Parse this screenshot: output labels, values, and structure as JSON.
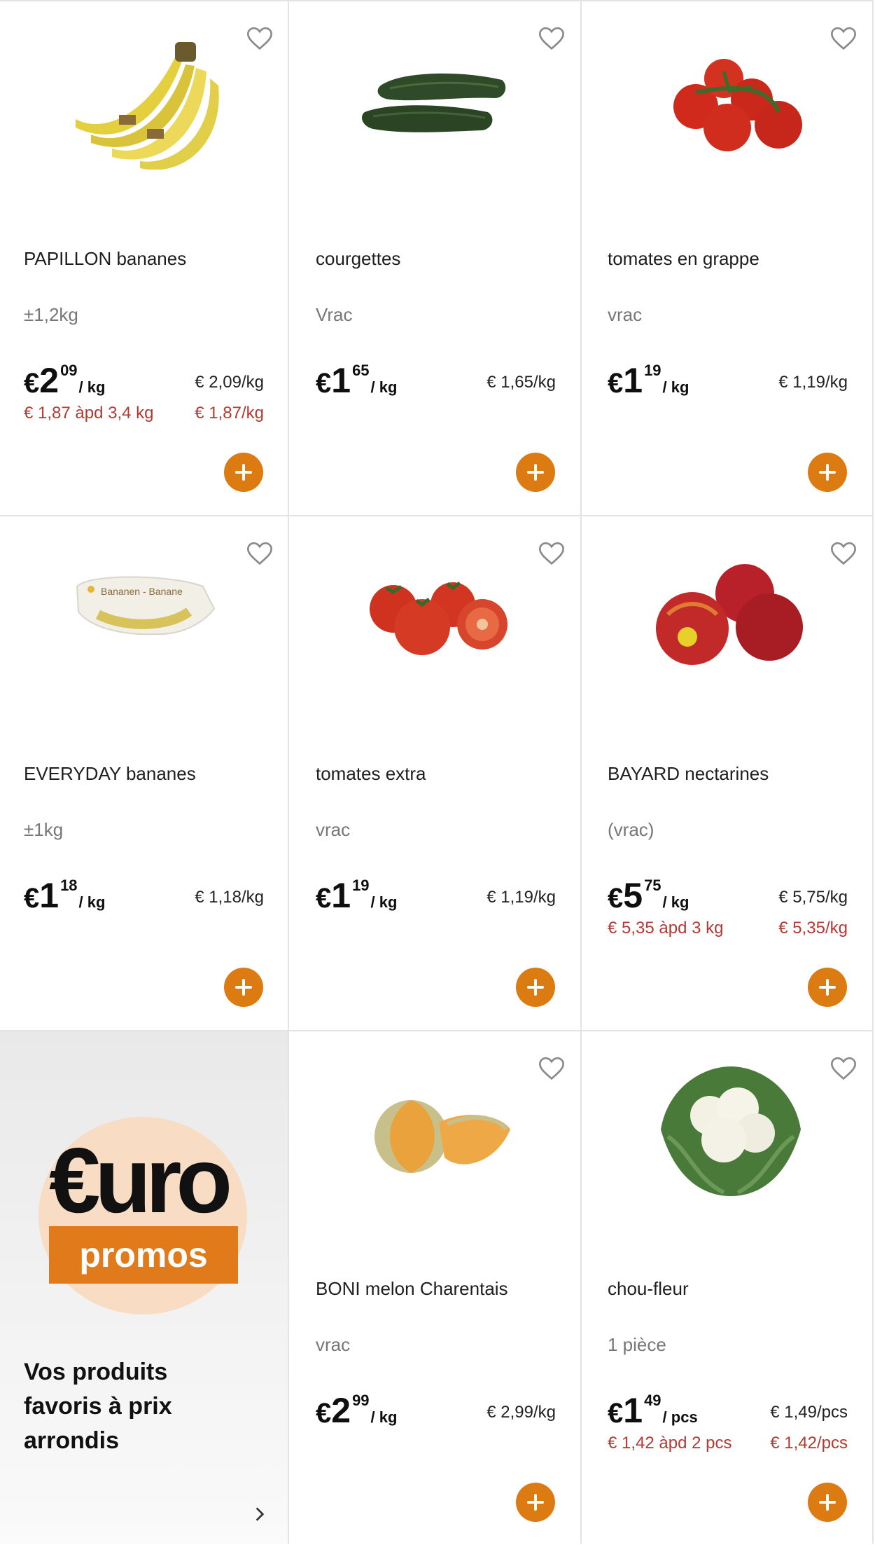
{
  "colors": {
    "accent": "#dc7b12",
    "promo_red": "#b23a33",
    "muted": "#777777",
    "border": "#e3e3e3"
  },
  "products": [
    {
      "name": "PAPILLON bananes",
      "quantity": "±1,2kg",
      "price": {
        "currency": "€",
        "int": "2",
        "cents": "09",
        "unit": "/ kg"
      },
      "unit_price": "€ 2,09/kg",
      "promo_text": "€ 1,87 àpd 3,4 kg",
      "promo_unit_price": "€ 1,87/kg",
      "image_icon": "bananas-image",
      "favorite_icon": "heart-outline-icon",
      "add_icon": "plus-icon"
    },
    {
      "name": "courgettes",
      "quantity": "Vrac",
      "price": {
        "currency": "€",
        "int": "1",
        "cents": "65",
        "unit": "/ kg"
      },
      "unit_price": "€ 1,65/kg",
      "image_icon": "courgettes-image",
      "favorite_icon": "heart-outline-icon",
      "add_icon": "plus-icon"
    },
    {
      "name": "tomates en grappe",
      "quantity": "vrac",
      "price": {
        "currency": "€",
        "int": "1",
        "cents": "19",
        "unit": "/ kg"
      },
      "unit_price": "€ 1,19/kg",
      "image_icon": "vine-tomatoes-image",
      "favorite_icon": "heart-outline-icon",
      "add_icon": "plus-icon"
    },
    {
      "name": "EVERYDAY bananes",
      "quantity": "±1kg",
      "price": {
        "currency": "€",
        "int": "1",
        "cents": "18",
        "unit": "/ kg"
      },
      "unit_price": "€ 1,18/kg",
      "image_icon": "bagged-bananas-image",
      "favorite_icon": "heart-outline-icon",
      "add_icon": "plus-icon"
    },
    {
      "name": "tomates extra",
      "quantity": "vrac",
      "price": {
        "currency": "€",
        "int": "1",
        "cents": "19",
        "unit": "/ kg"
      },
      "unit_price": "€ 1,19/kg",
      "image_icon": "tomatoes-image",
      "favorite_icon": "heart-outline-icon",
      "add_icon": "plus-icon"
    },
    {
      "name": "BAYARD nectarines",
      "quantity": "(vrac)",
      "price": {
        "currency": "€",
        "int": "5",
        "cents": "75",
        "unit": "/ kg"
      },
      "unit_price": "€ 5,75/kg",
      "promo_text": "€ 5,35 àpd 3 kg",
      "promo_unit_price": "€ 5,35/kg",
      "image_icon": "nectarines-image",
      "favorite_icon": "heart-outline-icon",
      "add_icon": "plus-icon"
    },
    {
      "name": "BONI melon Charentais",
      "quantity": "vrac",
      "price": {
        "currency": "€",
        "int": "2",
        "cents": "99",
        "unit": "/ kg"
      },
      "unit_price": "€ 2,99/kg",
      "image_icon": "melon-image",
      "favorite_icon": "heart-outline-icon",
      "add_icon": "plus-icon"
    },
    {
      "name": "chou-fleur",
      "quantity": "1 pièce",
      "price": {
        "currency": "€",
        "int": "1",
        "cents": "49",
        "unit": "/ pcs"
      },
      "unit_price": "€ 1,49/pcs",
      "promo_text": "€ 1,42 àpd 2 pcs",
      "promo_unit_price": "€ 1,42/pcs",
      "image_icon": "cauliflower-image",
      "favorite_icon": "heart-outline-icon",
      "add_icon": "plus-icon"
    }
  ],
  "promo_banner": {
    "logo_euro": "€uro",
    "logo_promos": "promos",
    "tagline": "Vos produits favoris à prix arrondis",
    "chevron_icon": "chevron-right-icon",
    "colors": {
      "circle": "#f8dcc3",
      "box": "#e07a1b"
    }
  }
}
